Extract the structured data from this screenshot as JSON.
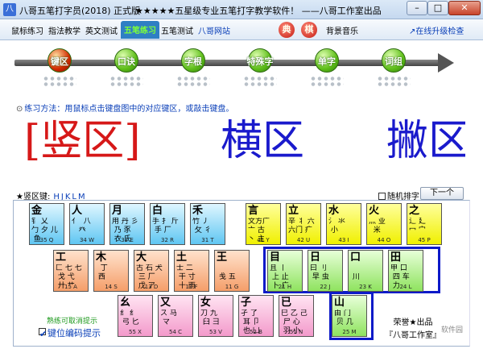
{
  "window": {
    "title": "八哥五笔打字员(2018) 正式版",
    "center_title": "★★★★★五星级专业五笔打字教学软件！ ——八哥工作室出品",
    "min_label": "–",
    "max_label": "□",
    "close_label": "✕"
  },
  "menu": {
    "items": [
      "鼠标练习",
      "指法教学",
      "英文测试",
      "五笔练习",
      "五笔测试",
      "八哥网站"
    ],
    "active_index": 3,
    "badge1": "典",
    "badge2": "棋",
    "music": "背景音乐",
    "upgrade": "↗在线升级检查"
  },
  "steps": {
    "items": [
      "键区",
      "口诀",
      "字根",
      "特殊字",
      "单字",
      "词组"
    ],
    "active_index": 0
  },
  "instruction": {
    "icon": "⊙",
    "text": "练习方法：用鼠标点击键盘图中的对应键区，或敲击键盘。"
  },
  "practice": {
    "word1": "[竖区]",
    "word2": "横区",
    "word3": "撇区"
  },
  "keyboard": {
    "zone_label": "★竖区键:",
    "zone_keys": "HJKLM",
    "random_label": "随机排字",
    "next_label": "下一个",
    "keys": [
      {
        "main": "言",
        "sub": "文方广\n亠 古\n丶 主",
        "code": "41 Y",
        "color": "yellow"
      },
      {
        "main": "立",
        "sub": "辛 丬 六\n六门 疒",
        "code": "42 U",
        "color": "yellow"
      },
      {
        "main": "水",
        "sub": "氵 氺\n 小",
        "code": "43 I",
        "color": "yellow"
      },
      {
        "main": "火",
        "sub": "灬 业\n  米",
        "code": "44 O",
        "color": "yellow"
      },
      {
        "main": "之",
        "sub": "辶 廴\n冖 宀",
        "code": "45 P",
        "color": "yellow"
      },
      {
        "main": "金",
        "sub": "钅 乂\n勹 夕 儿\n 鱼",
        "code": "35 Q",
        "color": "cyan"
      },
      {
        "main": "人",
        "sub": "亻  八\n   癶",
        "code": "34 W",
        "color": "cyan"
      },
      {
        "main": "月",
        "sub": "用 丹 彡\n 乃 豕\n 衣 氏",
        "code": "33 E",
        "color": "cyan"
      },
      {
        "main": "白",
        "sub": "手 扌 斤\n 手 厂",
        "code": "32 R",
        "color": "cyan"
      },
      {
        "main": "禾",
        "sub": "竹 丿\n 攵 彳",
        "code": "31 T",
        "color": "cyan"
      },
      {
        "main": "工",
        "sub": "匚 七 七\n 戈 弋\n 廾 艹",
        "code": "15 A",
        "color": "orange"
      },
      {
        "main": "木",
        "sub": "  丁\n 西",
        "code": "14 S",
        "color": "orange"
      },
      {
        "main": "大",
        "sub": "古 石 犬\n 三 厂\n 戊 ア",
        "code": "13 D",
        "color": "orange"
      },
      {
        "main": "土",
        "sub": "士 二\n 干 寸\n 十 雨",
        "code": "12 F",
        "color": "orange"
      },
      {
        "main": "王",
        "sub": "\n 戋 五",
        "code": "11 G",
        "color": "orange"
      },
      {
        "main": "目",
        "sub": "且 丨\n 上 止\n 卜 广",
        "code": "21 H",
        "color": "green"
      },
      {
        "main": "日",
        "sub": "曰 刂\n 早 虫",
        "code": "22 J",
        "color": "green"
      },
      {
        "main": "口",
        "sub": "\n 川",
        "code": "23 K",
        "color": "green"
      },
      {
        "main": "田",
        "sub": "甲 口\n 四 车\n 力",
        "code": "24 L",
        "color": "green"
      },
      {
        "main": "山",
        "sub": "由 门\n 贝 几",
        "code": "25 M",
        "color": "green"
      },
      {
        "main": "幺",
        "sub": "纟 纟\n 弓 匕",
        "code": "55 X",
        "color": "pink"
      },
      {
        "main": "又",
        "sub": "ス 马\n マ",
        "code": "54 C",
        "color": "pink"
      },
      {
        "main": "女",
        "sub": "刀 九\n 臼 彐",
        "code": "53 V",
        "color": "pink"
      },
      {
        "main": "子",
        "sub": "孑 了\n 耳 卩\n 也 凵",
        "code": "52 B",
        "color": "pink"
      },
      {
        "main": "已",
        "sub": "巳 乙 己\n 尸 心\n 羽 小",
        "code": "51 N",
        "color": "pink"
      }
    ]
  },
  "bottom": {
    "hint": "熟练可取消提示",
    "keycode_label": "键位编码提示",
    "credit_line1": "荣誉★出品",
    "credit_line2": "『八哥工作室』",
    "watermark": "软件园"
  },
  "colors": {
    "active_menu_bg": "#2f7fc4",
    "active_menu_text": "#7cff3a",
    "big_word_blue": "#1a1acc",
    "big_word_red": "#d61818",
    "highlight_border": "#0d1ac8",
    "yellow_key": "#f0f000",
    "cyan_key": "#5fc6f2",
    "orange_key": "#f59e69",
    "green_key": "#8fe35f",
    "pink_key": "#f39acb"
  }
}
